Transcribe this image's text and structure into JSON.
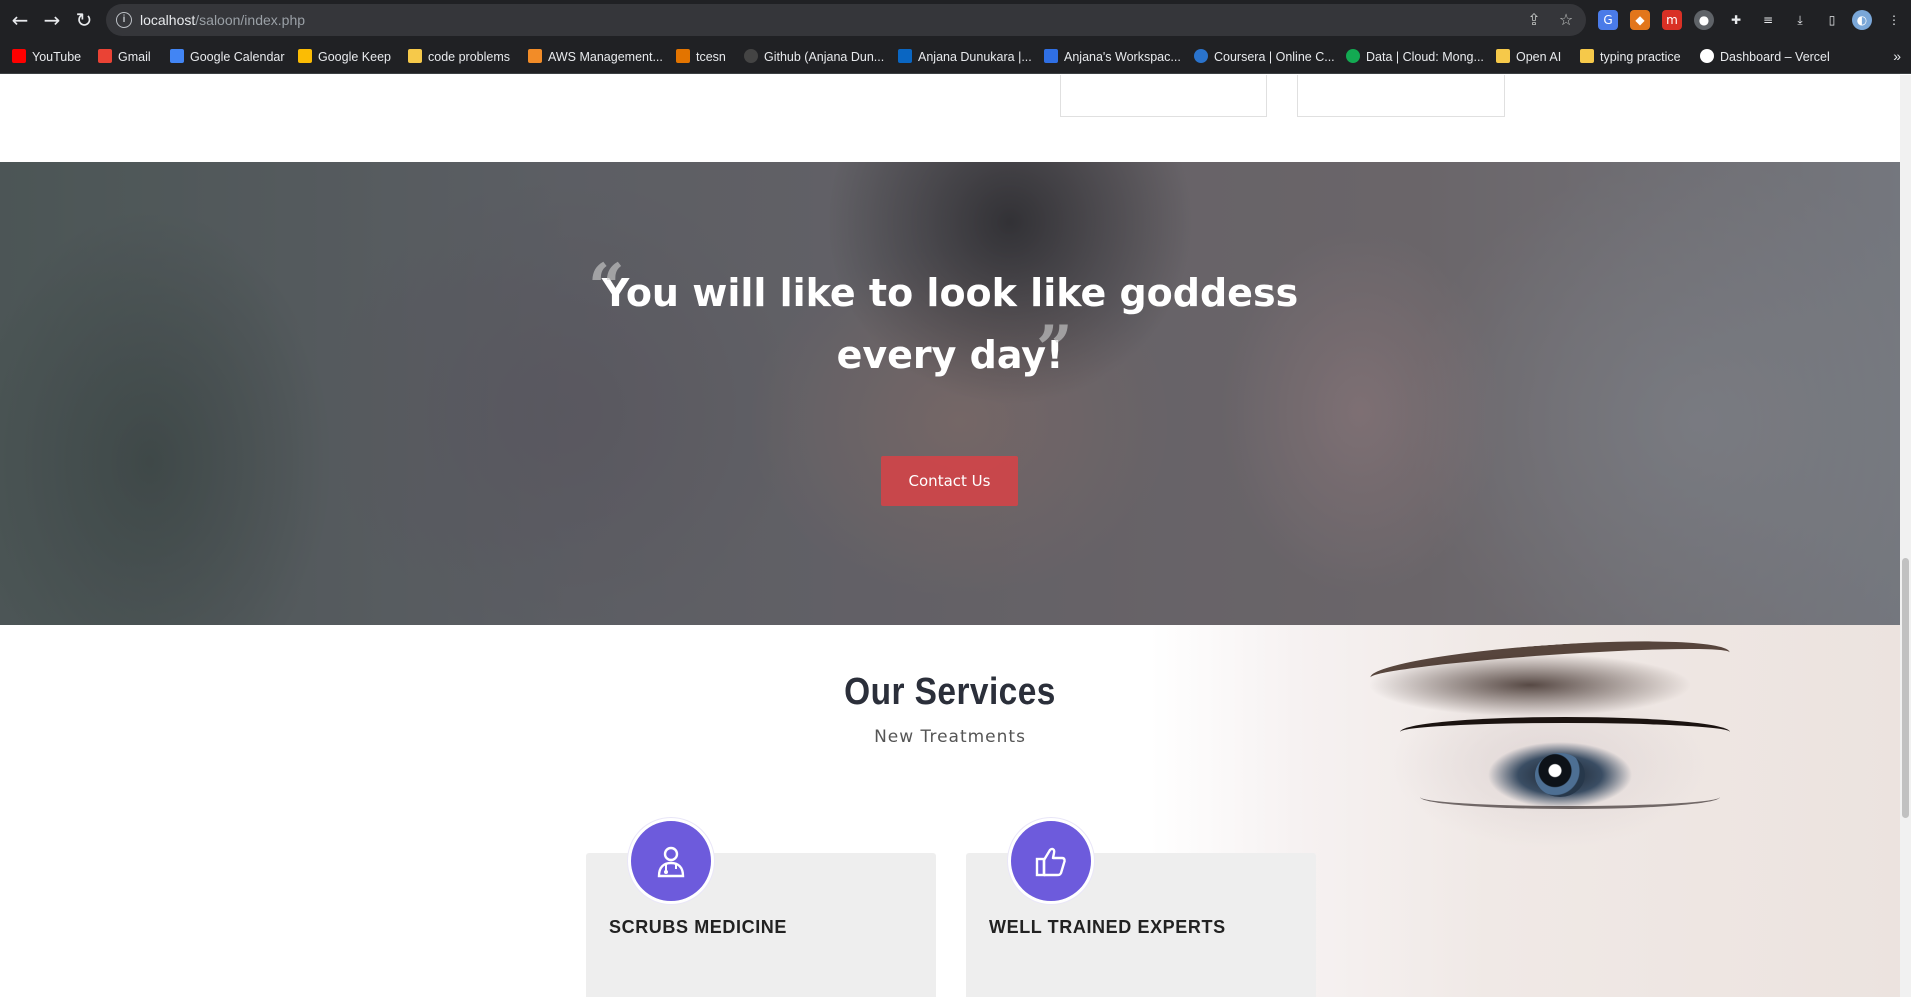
{
  "browser": {
    "url_host": "localhost",
    "url_path": "/saloon/index.php",
    "bookmarks": [
      {
        "label": "YouTube",
        "color": "#ff0000"
      },
      {
        "label": "Gmail",
        "color": "#ea4335"
      },
      {
        "label": "Google Calendar",
        "color": "#4285f4"
      },
      {
        "label": "Google Keep",
        "color": "#fbbc04"
      },
      {
        "label": "code problems",
        "color": "#f6c94a"
      },
      {
        "label": "AWS Management...",
        "color": "#f28c28"
      },
      {
        "label": "tcesn",
        "color": "#e37400"
      },
      {
        "label": "Github (Anjana Dun...",
        "color": "#444444"
      },
      {
        "label": "Anjana Dunukara |...",
        "color": "#0a66c2"
      },
      {
        "label": "Anjana's Workspac...",
        "color": "#2f6fe4"
      },
      {
        "label": "Coursera | Online C...",
        "color": "#2a73cc"
      },
      {
        "label": "Data | Cloud: Mong...",
        "color": "#13aa52"
      },
      {
        "label": "Open AI",
        "color": "#f6c94a"
      },
      {
        "label": "typing practice",
        "color": "#f6c94a"
      },
      {
        "label": "Dashboard – Vercel",
        "color": "#ffffff"
      }
    ],
    "more_label": "»"
  },
  "hero": {
    "quote": "You will like to look like goddess every day!",
    "open_quote": "“",
    "close_quote": "”",
    "cta_label": "Contact Us"
  },
  "services": {
    "title": "Our Services",
    "subtitle": "New Treatments",
    "items": [
      {
        "name": "SCRUBS MEDICINE",
        "icon": "doctor-icon"
      },
      {
        "name": "WELL TRAINED EXPERTS",
        "icon": "thumbs-up-icon"
      }
    ]
  },
  "colors": {
    "accent": "#6d5bdc",
    "cta": "#d84246",
    "browser_bg": "#202124"
  }
}
